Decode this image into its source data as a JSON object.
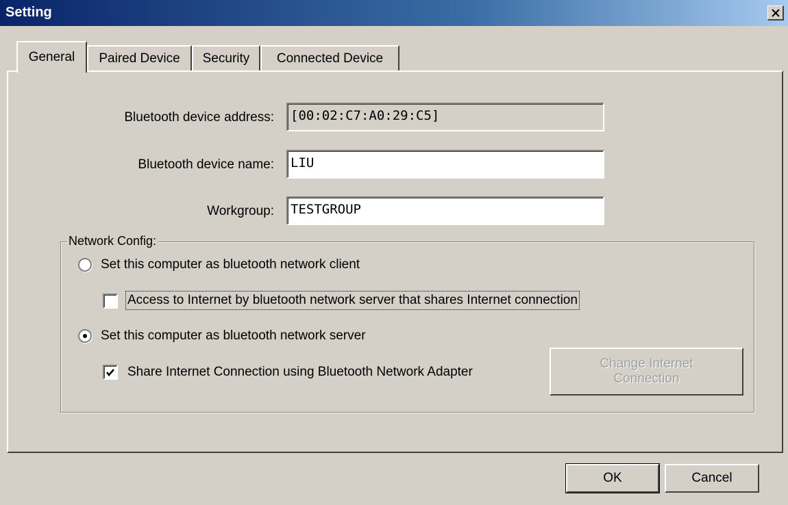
{
  "window": {
    "title": "Setting",
    "close_icon": "close-icon"
  },
  "tabs": [
    {
      "label": "General",
      "active": true
    },
    {
      "label": "Paired Device",
      "active": false
    },
    {
      "label": "Security",
      "active": false
    },
    {
      "label": "Connected Device",
      "active": false
    }
  ],
  "general": {
    "address_label": "Bluetooth device address:",
    "address_value": "[00:02:C7:A0:29:C5]",
    "name_label": "Bluetooth device name:",
    "name_value": "LIU",
    "workgroup_label": "Workgroup:",
    "workgroup_value": "TESTGROUP"
  },
  "network_config": {
    "title": "Network Config:",
    "client_option": "Set this computer as bluetooth network client",
    "client_selected": false,
    "internet_access_option": "Access to Internet by bluetooth network server that shares Internet connection",
    "internet_access_checked": false,
    "server_option": "Set this computer as bluetooth network server",
    "server_selected": true,
    "share_option": "Share Internet Connection using Bluetooth Network Adapter",
    "share_checked": true,
    "change_button": "Change Internet Connection",
    "change_button_enabled": false
  },
  "buttons": {
    "ok": "OK",
    "cancel": "Cancel"
  }
}
